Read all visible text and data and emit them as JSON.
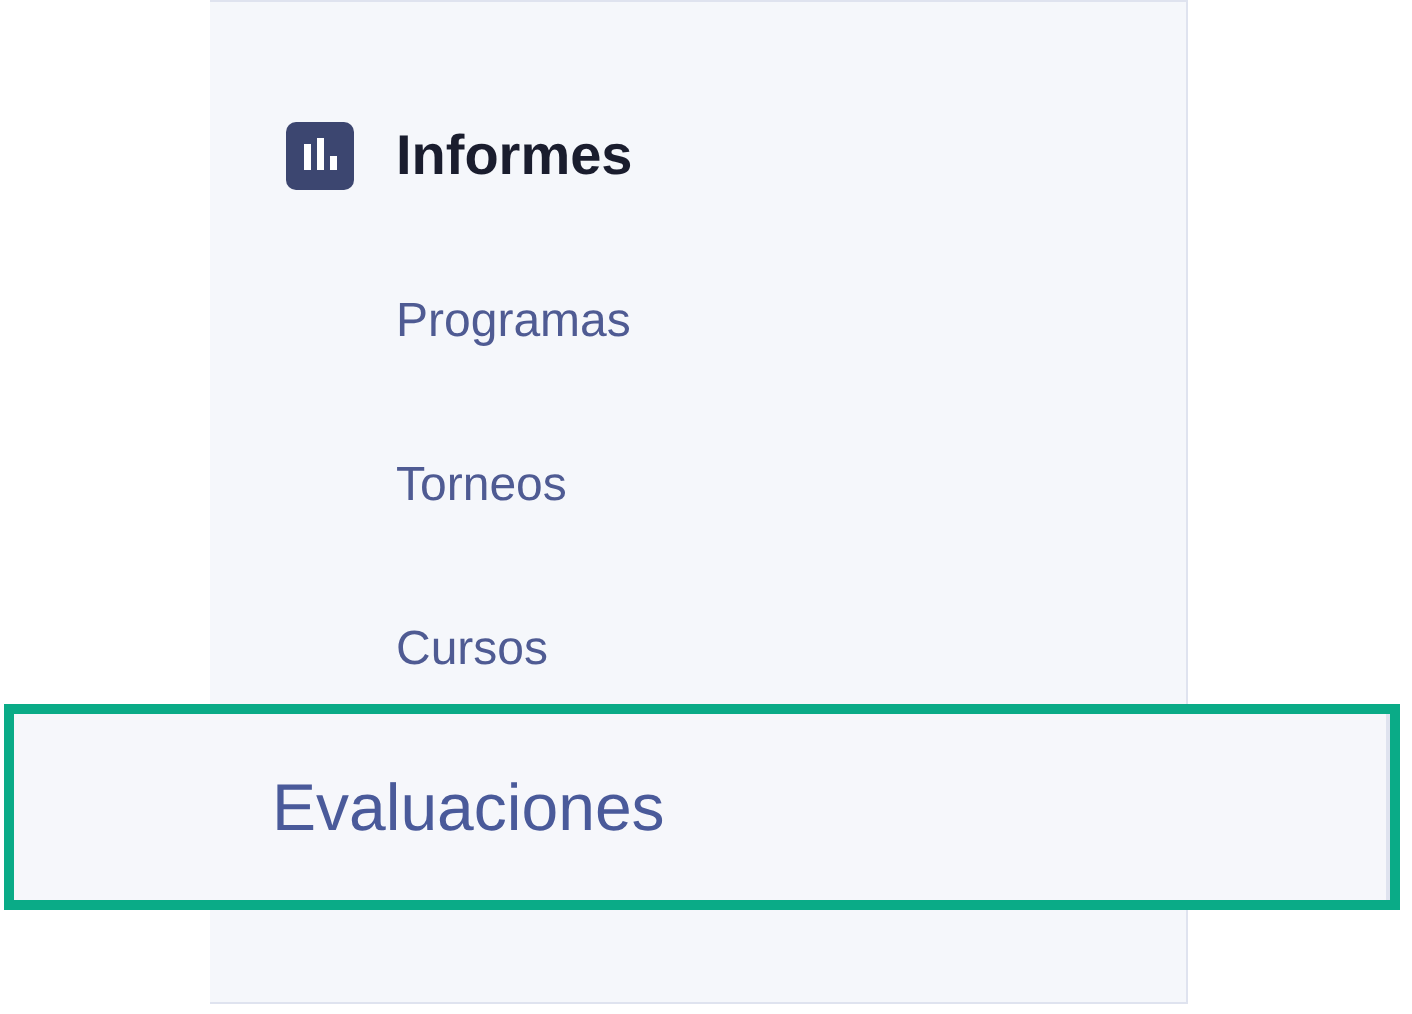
{
  "section": {
    "title": "Informes"
  },
  "items": [
    {
      "label": "Programas",
      "highlighted": false
    },
    {
      "label": "Torneos",
      "highlighted": false
    },
    {
      "label": "Cursos",
      "highlighted": false
    },
    {
      "label": "Evaluaciones",
      "highlighted": true
    }
  ]
}
